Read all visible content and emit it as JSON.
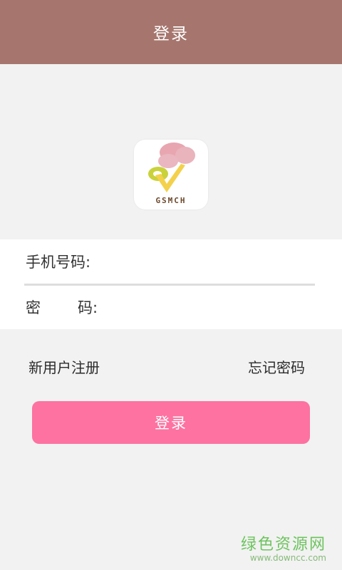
{
  "header": {
    "title": "登录"
  },
  "logo": {
    "text": "GSMCH"
  },
  "form": {
    "phone_label": "手机号码:",
    "phone_value": "",
    "password_label_first": "密",
    "password_label_last": "码:",
    "password_value": ""
  },
  "links": {
    "register": "新用户注册",
    "forgot": "忘记密码"
  },
  "login_button": {
    "label": "登录"
  },
  "watermark": {
    "main": "绿色资源网",
    "sub": "www.downcc.com"
  },
  "colors": {
    "header": "#a6766e",
    "button": "#fd72a1",
    "background": "#f2f2f2"
  }
}
